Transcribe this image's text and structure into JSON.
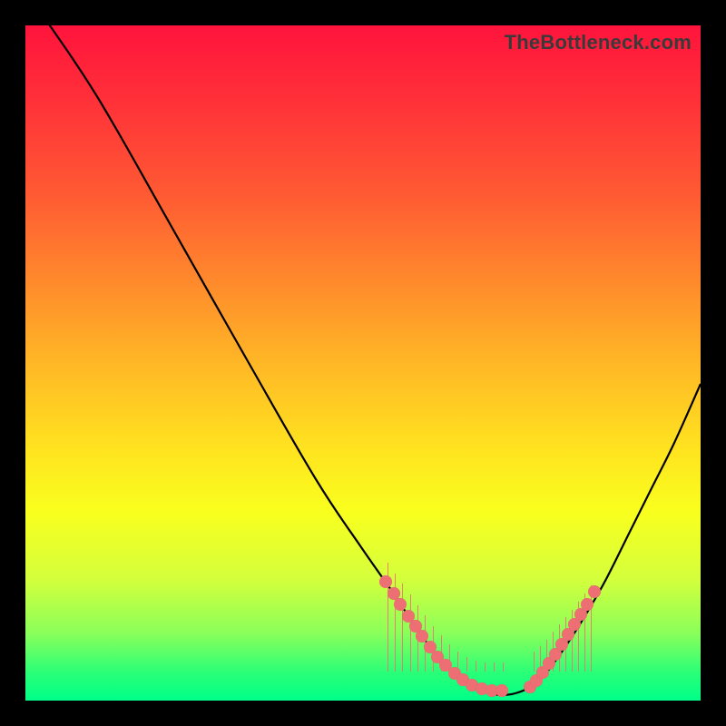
{
  "watermark": "TheBottleneck.com",
  "chart_data": {
    "type": "line",
    "title": "",
    "xlabel": "",
    "ylabel": "",
    "xlim": [
      0,
      744
    ],
    "ylim": [
      0,
      744
    ],
    "curve_points": [
      [
        20,
        -10
      ],
      [
        80,
        80
      ],
      [
        160,
        220
      ],
      [
        245,
        370
      ],
      [
        320,
        500
      ],
      [
        370,
        575
      ],
      [
        405,
        625
      ],
      [
        428,
        660
      ],
      [
        450,
        690
      ],
      [
        475,
        715
      ],
      [
        500,
        730
      ],
      [
        525,
        738
      ],
      [
        555,
        730
      ],
      [
        575,
        712
      ],
      [
        600,
        677
      ],
      [
        620,
        645
      ],
      [
        640,
        610
      ],
      [
        665,
        560
      ],
      [
        690,
        510
      ],
      [
        715,
        460
      ],
      [
        744,
        395
      ]
    ],
    "left_marker_points": [
      [
        397,
        613
      ],
      [
        406,
        626
      ],
      [
        413,
        638
      ],
      [
        422,
        651
      ],
      [
        430,
        662
      ],
      [
        437,
        673
      ],
      [
        446,
        685
      ],
      [
        454,
        696
      ],
      [
        463,
        705
      ],
      [
        473,
        714
      ],
      [
        482,
        721
      ],
      [
        492,
        727
      ],
      [
        503,
        731
      ],
      [
        514,
        733
      ],
      [
        525,
        733
      ]
    ],
    "right_marker_points": [
      [
        556,
        729
      ],
      [
        563,
        722
      ],
      [
        570,
        713
      ],
      [
        577,
        703
      ],
      [
        584,
        693
      ],
      [
        591,
        682
      ],
      [
        598,
        671
      ],
      [
        605,
        660
      ],
      [
        612,
        649
      ],
      [
        619,
        638
      ],
      [
        627,
        624
      ]
    ],
    "right_ticks": [
      {
        "x": 560,
        "h": 22
      },
      {
        "x": 567,
        "h": 28
      },
      {
        "x": 574,
        "h": 35
      },
      {
        "x": 581,
        "h": 44
      },
      {
        "x": 588,
        "h": 52
      },
      {
        "x": 595,
        "h": 60
      },
      {
        "x": 602,
        "h": 68
      },
      {
        "x": 609,
        "h": 77
      },
      {
        "x": 616,
        "h": 86
      },
      {
        "x": 623,
        "h": 95
      }
    ],
    "left_ticks": [
      {
        "x": 399,
        "h": 120
      },
      {
        "x": 407,
        "h": 108
      },
      {
        "x": 415,
        "h": 97
      },
      {
        "x": 424,
        "h": 85
      },
      {
        "x": 432,
        "h": 73
      },
      {
        "x": 440,
        "h": 62
      },
      {
        "x": 449,
        "h": 50
      },
      {
        "x": 458,
        "h": 40
      },
      {
        "x": 467,
        "h": 30
      },
      {
        "x": 476,
        "h": 22
      },
      {
        "x": 486,
        "h": 16
      },
      {
        "x": 496,
        "h": 12
      },
      {
        "x": 506,
        "h": 10
      },
      {
        "x": 516,
        "h": 10
      },
      {
        "x": 526,
        "h": 10
      }
    ]
  }
}
